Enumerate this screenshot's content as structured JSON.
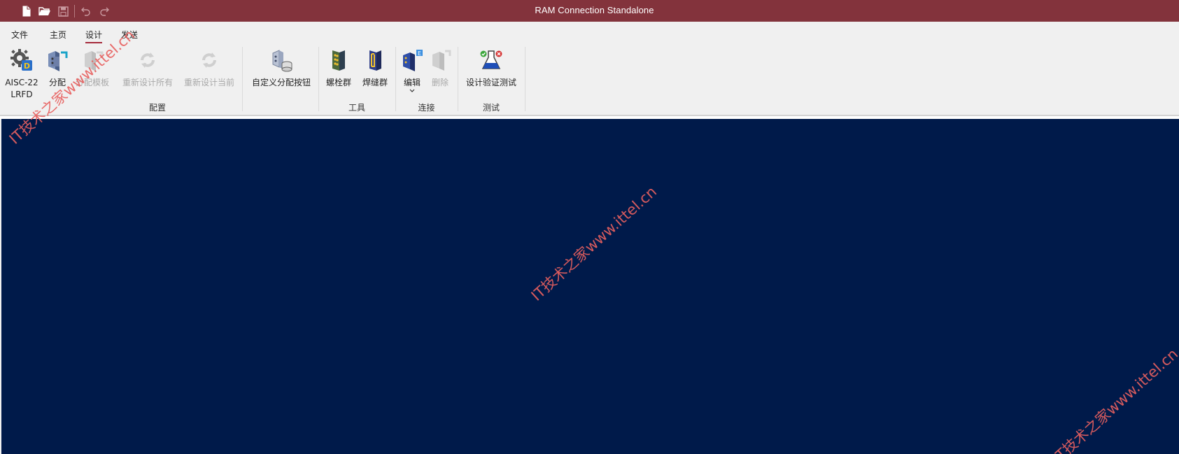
{
  "app": {
    "title": "RAM Connection Standalone",
    "accent_color": "#83333c",
    "canvas_color": "#001a4a"
  },
  "qat": {
    "icons": [
      "new-file-icon",
      "open-folder-icon",
      "save-icon",
      "undo-icon",
      "redo-icon"
    ]
  },
  "tabs": [
    {
      "label": "文件"
    },
    {
      "label": "主页"
    },
    {
      "label": "设计",
      "active": true
    },
    {
      "label": "发送"
    }
  ],
  "ribbon": {
    "buttons": {
      "code": {
        "line1": "AISC-22",
        "line2": "LRFD",
        "icon": "gear-settings-icon"
      },
      "assign": {
        "label": "分配",
        "icon": "assign-icon"
      },
      "assign_template": {
        "label": "分配模板",
        "icon": "assign-template-icon",
        "disabled": true
      },
      "redesign_all": {
        "label": "重新设计所有",
        "icon": "redesign-all-icon",
        "disabled": true
      },
      "redesign_current": {
        "label": "重新设计当前",
        "icon": "redesign-current-icon",
        "disabled": true
      },
      "custom_assign": {
        "label": "自定义分配按钮",
        "icon": "custom-assign-icon"
      },
      "bolt_group": {
        "label": "螺栓群",
        "icon": "bolt-group-icon"
      },
      "weld_group": {
        "label": "焊缝群",
        "icon": "weld-group-icon"
      },
      "edit": {
        "label": "编辑",
        "icon": "edit-connection-icon",
        "dropdown": true
      },
      "delete": {
        "label": "删除",
        "icon": "delete-connection-icon",
        "disabled": true
      },
      "verify": {
        "label": "设计验证测试",
        "icon": "flask-test-icon"
      }
    },
    "groups": {
      "config": "配置",
      "tools": "工具",
      "connection": "连接",
      "test": "测试"
    }
  },
  "watermark": {
    "text": "IT技术之家www.ittel.cn"
  }
}
